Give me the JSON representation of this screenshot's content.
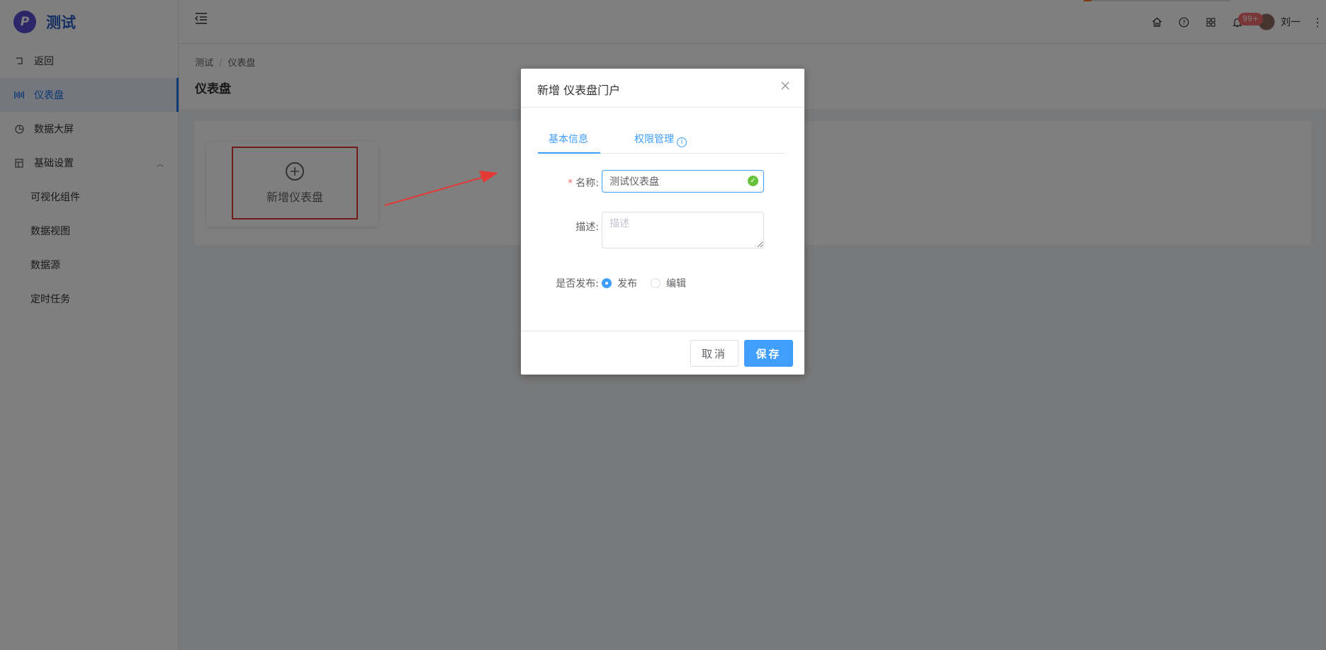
{
  "app": {
    "logo_glyph": "P",
    "name": "测试"
  },
  "sidebar": {
    "items": [
      {
        "label": "返回",
        "icon": "back-icon"
      },
      {
        "label": "仪表盘",
        "icon": "dashboard-icon"
      },
      {
        "label": "数据大屏",
        "icon": "pie-chart-icon"
      },
      {
        "label": "基础设置",
        "icon": "settings-grid-icon"
      }
    ],
    "sub_items": [
      "可视化组件",
      "数据视图",
      "数据源",
      "定时任务"
    ]
  },
  "header": {
    "badge": "99+",
    "username": "刘一"
  },
  "breadcrumb": {
    "root": "测试",
    "current": "仪表盘"
  },
  "page_title": "仪表盘",
  "add_card": {
    "label": "新增仪表盘"
  },
  "dialog": {
    "title": "新增 仪表盘门户",
    "tabs": [
      "基本信息",
      "权限管理"
    ],
    "name_label": "名称:",
    "name_value": "测试仪表盘",
    "desc_label": "描述:",
    "desc_placeholder": "描述",
    "publish_label": "是否发布:",
    "publish_options": [
      "发布",
      "编辑"
    ],
    "publish_selected": "发布",
    "cancel_label": "取消",
    "save_label": "保存"
  },
  "colors": {
    "primary": "#409eff",
    "active_nav": "#1a73e8",
    "highlight": "#e53935",
    "success": "#67c23a"
  }
}
